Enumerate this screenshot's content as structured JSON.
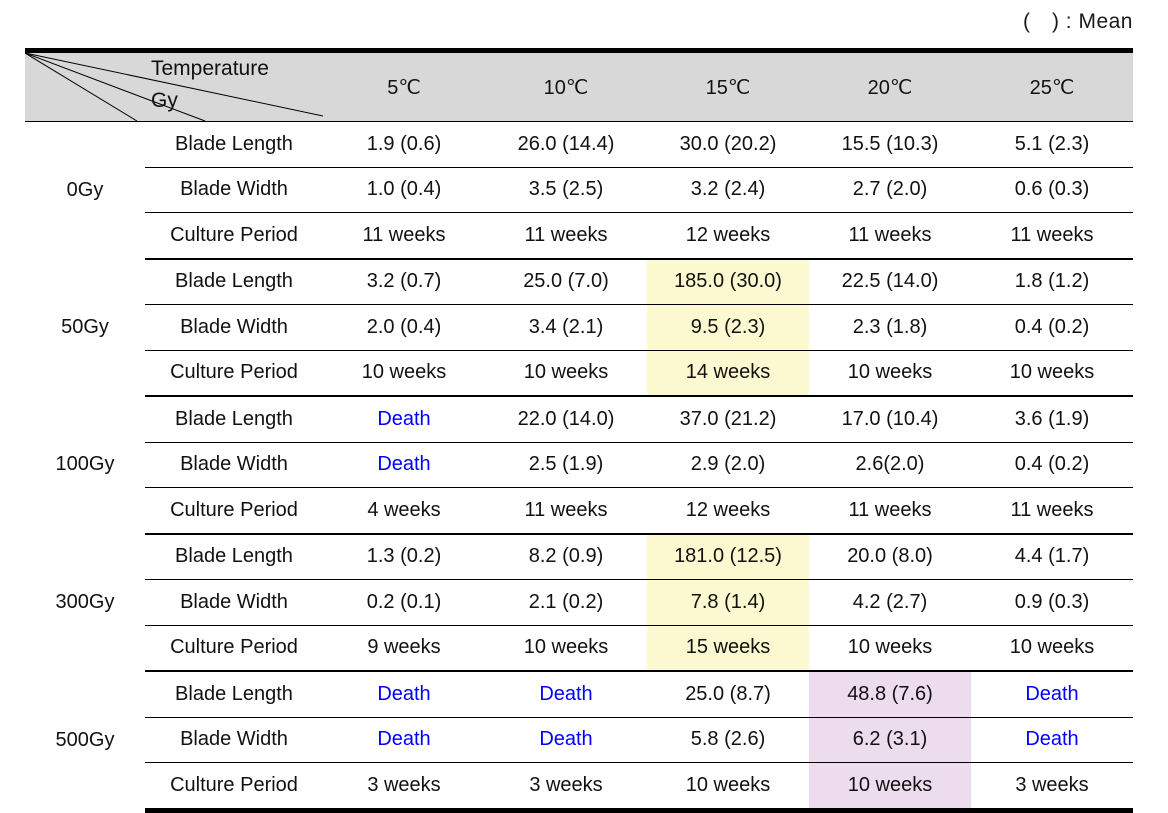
{
  "caption": "(　) : Mean",
  "header": {
    "row_label_header": "Gy",
    "col_label_header": "Temperature",
    "temperatures": [
      "5℃",
      "10℃",
      "15℃",
      "20℃",
      "25℃"
    ]
  },
  "metrics": [
    "Blade Length",
    "Blade Width",
    "Culture Period"
  ],
  "colors": {
    "header_fill": "#d8d8d8",
    "highlight_yellow": "#fcf8cf",
    "highlight_purple": "#eddced",
    "death_text": "#0000ff",
    "rule": "#000000"
  },
  "groups": [
    {
      "dose": "0Gy",
      "rows": [
        {
          "metric": "Blade Length",
          "values": [
            "1.9 (0.6)",
            "26.0 (14.4)",
            "30.0 (20.2)",
            "15.5 (10.3)",
            "5.1 (2.3)"
          ]
        },
        {
          "metric": "Blade Width",
          "values": [
            "1.0 (0.4)",
            "3.5 (2.5)",
            "3.2 (2.4)",
            "2.7 (2.0)",
            "0.6 (0.3)"
          ]
        },
        {
          "metric": "Culture Period",
          "values": [
            "11 weeks",
            "11 weeks",
            "12 weeks",
            "11 weeks",
            "11 weeks"
          ]
        }
      ]
    },
    {
      "dose": "50Gy",
      "rows": [
        {
          "metric": "Blade Length",
          "values": [
            "3.2 (0.7)",
            "25.0 (7.0)",
            "185.0 (30.0)",
            "22.5 (14.0)",
            "1.8 (1.2)"
          ]
        },
        {
          "metric": "Blade Width",
          "values": [
            "2.0 (0.4)",
            "3.4 (2.1)",
            "9.5 (2.3)",
            "2.3 (1.8)",
            "0.4 (0.2)"
          ]
        },
        {
          "metric": "Culture Period",
          "values": [
            "10 weeks",
            "10 weeks",
            "14 weeks",
            "10 weeks",
            "10 weeks"
          ]
        }
      ]
    },
    {
      "dose": "100Gy",
      "rows": [
        {
          "metric": "Blade Length",
          "values": [
            "Death",
            "22.0 (14.0)",
            "37.0 (21.2)",
            "17.0 (10.4)",
            "3.6 (1.9)"
          ]
        },
        {
          "metric": "Blade Width",
          "values": [
            "Death",
            "2.5 (1.9)",
            "2.9 (2.0)",
            "2.6(2.0)",
            "0.4 (0.2)"
          ]
        },
        {
          "metric": "Culture Period",
          "values": [
            "4 weeks",
            "11 weeks",
            "12 weeks",
            "11 weeks",
            "11 weeks"
          ]
        }
      ]
    },
    {
      "dose": "300Gy",
      "rows": [
        {
          "metric": "Blade Length",
          "values": [
            "1.3 (0.2)",
            "8.2 (0.9)",
            "181.0 (12.5)",
            "20.0 (8.0)",
            "4.4 (1.7)"
          ]
        },
        {
          "metric": "Blade Width",
          "values": [
            "0.2 (0.1)",
            "2.1 (0.2)",
            "7.8 (1.4)",
            "4.2 (2.7)",
            "0.9 (0.3)"
          ]
        },
        {
          "metric": "Culture Period",
          "values": [
            "9 weeks",
            "10 weeks",
            "15 weeks",
            "10 weeks",
            "10 weeks"
          ]
        }
      ]
    },
    {
      "dose": "500Gy",
      "rows": [
        {
          "metric": "Blade Length",
          "values": [
            "Death",
            "Death",
            "25.0 (8.7)",
            "48.8 (7.6)",
            "Death"
          ]
        },
        {
          "metric": "Blade Width",
          "values": [
            "Death",
            "Death",
            "5.8 (2.6)",
            "6.2 (3.1)",
            "Death"
          ]
        },
        {
          "metric": "Culture Period",
          "values": [
            "3 weeks",
            "3 weeks",
            "10 weeks",
            "10 weeks",
            "3 weeks"
          ]
        }
      ]
    }
  ],
  "highlights": [
    {
      "group": "50Gy",
      "column": "15℃",
      "style": "yellow"
    },
    {
      "group": "300Gy",
      "column": "15℃",
      "style": "yellow"
    },
    {
      "group": "500Gy",
      "column": "20℃",
      "style": "purple"
    }
  ]
}
